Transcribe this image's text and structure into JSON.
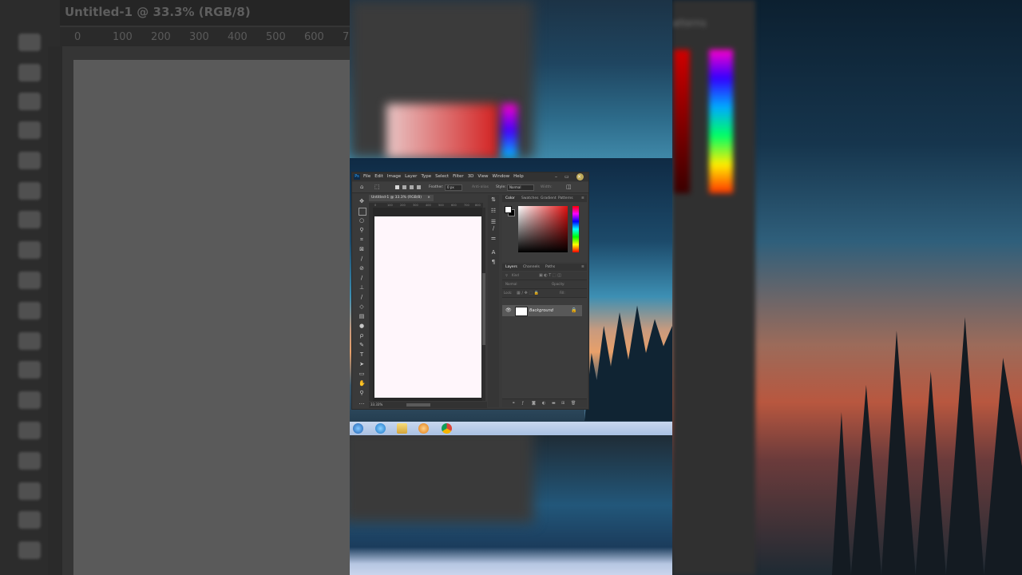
{
  "background_left": {
    "tab_title": "Untitled-1 @ 33.3% (RGB/8)",
    "ruler_ticks": [
      "0",
      "100",
      "200",
      "300",
      "400",
      "500",
      "600",
      "7"
    ]
  },
  "background_right": {
    "panel_label": "atterns"
  },
  "photoshop": {
    "app_icon": "Ps",
    "menu": [
      "File",
      "Edit",
      "Image",
      "Layer",
      "Type",
      "Select",
      "Filter",
      "3D",
      "View",
      "Window",
      "Help"
    ],
    "window_controls": {
      "minimize": "–",
      "maximize": "▭",
      "close": "×"
    },
    "options": {
      "feather_label": "Feather:",
      "feather_value": "0 px",
      "anti_alias": "Anti-alias",
      "style_label": "Style:",
      "style_value": "Normal",
      "width_label": "Width:"
    },
    "doc_tab": "Untitled-1 @ 33.3% (RGB/8)",
    "doc_ruler_ticks": [
      "0",
      "100",
      "200",
      "300",
      "400",
      "500",
      "600",
      "700",
      "800"
    ],
    "zoom_status": "33.33%",
    "color_panel_tabs": [
      "Color",
      "Swatches",
      "Gradient",
      "Patterns"
    ],
    "layers_panel_tabs": [
      "Layers",
      "Channels",
      "Paths"
    ],
    "layer_filter_label": "Kind",
    "blend_mode": "Normal",
    "opacity_label": "Opacity:",
    "lock_label": "Lock:",
    "fill_label": "Fill:",
    "layers": [
      {
        "name": "Background",
        "visible": true,
        "locked": true
      }
    ],
    "colors": {
      "foreground": "#ffffff",
      "background": "#000000",
      "accent": "#e01010"
    }
  },
  "taskbar": {
    "icons": [
      "start-orb-icon",
      "ie-icon",
      "folder-icon",
      "media-player-icon",
      "chrome-icon"
    ]
  }
}
